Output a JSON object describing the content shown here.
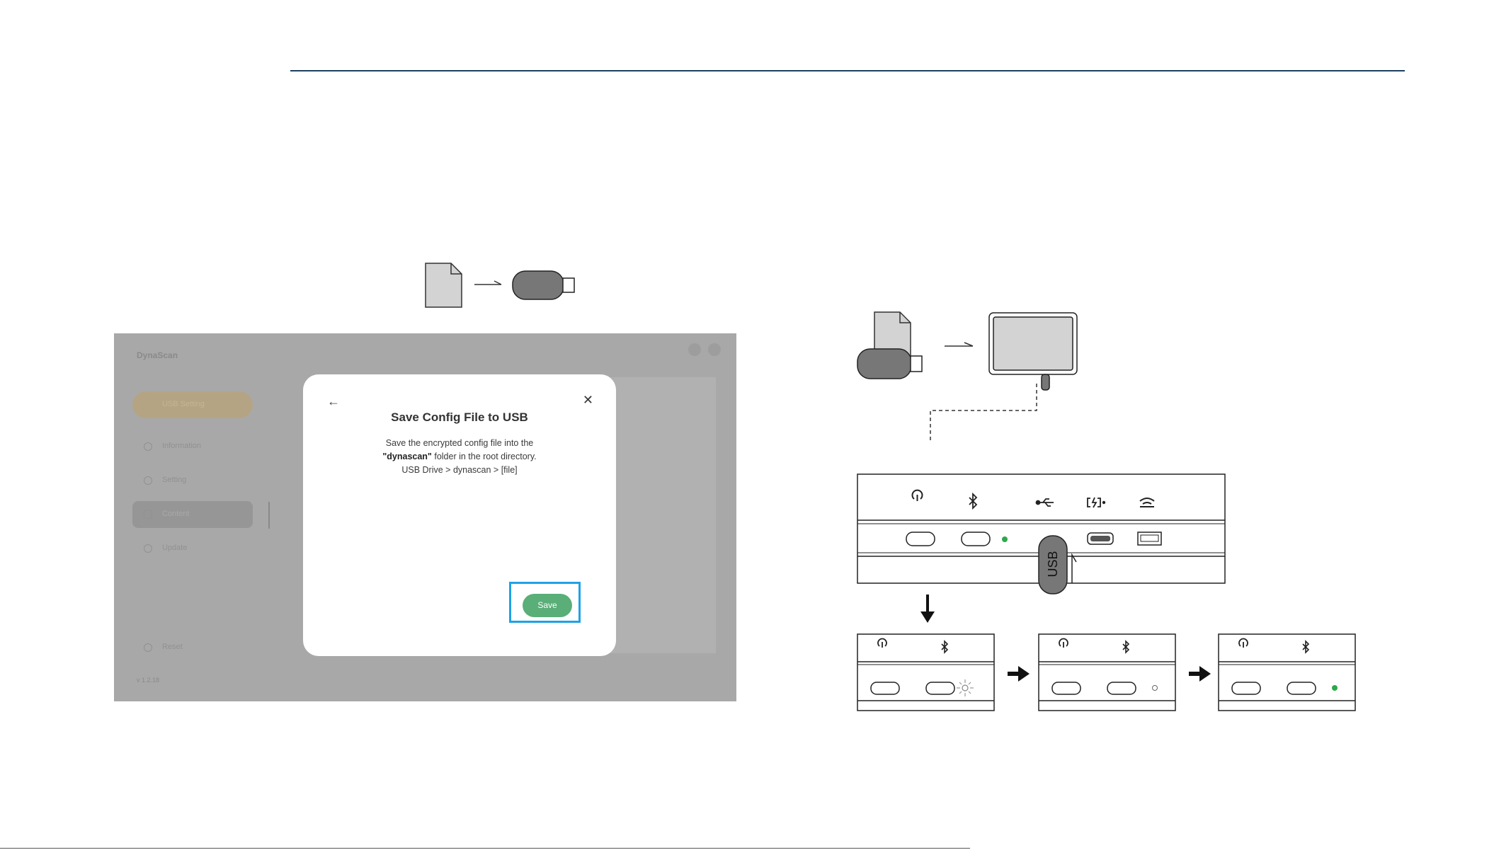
{
  "app": {
    "brand": "DynaScan",
    "usb_device_label": "USB Setting",
    "nav": [
      {
        "label": "Information"
      },
      {
        "label": "Setting"
      },
      {
        "label": "Content"
      },
      {
        "label": "Update"
      }
    ],
    "reset_label": "Reset",
    "version": "v 1.2.18"
  },
  "dialog": {
    "back_icon": "←",
    "close_icon": "✕",
    "title": "Save Config File to USB",
    "line1": "Save the encrypted config file into the",
    "folder_name": "\"dynascan\"",
    "line2_rest": " folder in the root directory.",
    "line3": "USB Drive > dynascan > [file]",
    "save_label": "Save"
  },
  "colors": {
    "rule": "#1c3f5e",
    "save_button": "#5aae78",
    "highlight": "#1ea2e6",
    "led_green": "#2ea84a"
  },
  "device": {
    "usb_stick_label": "USB"
  }
}
